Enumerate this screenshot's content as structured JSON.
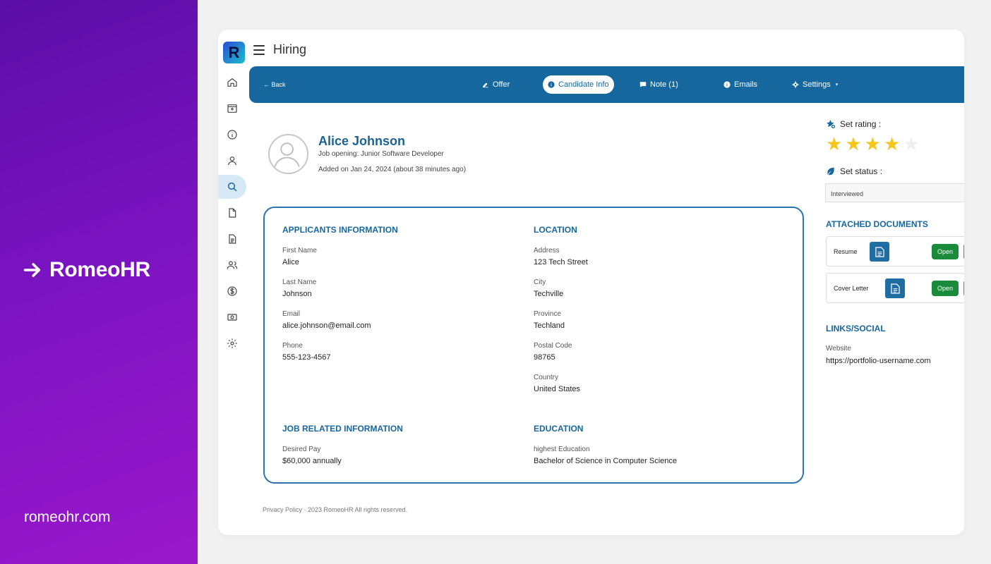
{
  "promo": {
    "brand": "RomeoHR",
    "url": "romeohr.com"
  },
  "app": {
    "logo_letter": "R",
    "title": "Hiring"
  },
  "sidebar": {
    "items": [
      {
        "icon": "home-icon"
      },
      {
        "icon": "inbox-icon"
      },
      {
        "icon": "info-icon"
      },
      {
        "icon": "user-icon"
      },
      {
        "icon": "search-icon",
        "active": true
      },
      {
        "icon": "file-icon"
      },
      {
        "icon": "document-icon"
      },
      {
        "icon": "users-icon"
      },
      {
        "icon": "dollar-icon"
      },
      {
        "icon": "cash-icon"
      },
      {
        "icon": "gear-icon"
      }
    ]
  },
  "nav": {
    "back": "← Back",
    "offer": "Offer",
    "candidate_info": "Candidate Info",
    "note": "Note (1)",
    "emails": "Emails",
    "settings": "Settings"
  },
  "candidate": {
    "name": "Alice Johnson",
    "job_opening": "Job opening: Junior Software Developer",
    "added": "Added on Jan 24, 2024 (about 38 minutes ago)"
  },
  "applicant": {
    "title": "APPLICANTS INFORMATION",
    "fields": [
      {
        "label": "First Name",
        "value": "Alice"
      },
      {
        "label": "Last Name",
        "value": "Johnson"
      },
      {
        "label": "Email",
        "value": "alice.johnson@email.com"
      },
      {
        "label": "Phone",
        "value": "555-123-4567"
      }
    ]
  },
  "location": {
    "title": "LOCATION",
    "fields": [
      {
        "label": "Address",
        "value": "123 Tech Street"
      },
      {
        "label": "City",
        "value": "Techville"
      },
      {
        "label": "Province",
        "value": "Techland"
      },
      {
        "label": "Postal Code",
        "value": "98765"
      },
      {
        "label": "Country",
        "value": "United States"
      }
    ]
  },
  "job": {
    "title": "JOB RELATED INFORMATION",
    "fields": [
      {
        "label": "Desired Pay",
        "value": "$60,000 annually"
      }
    ]
  },
  "education": {
    "title": "EDUCATION",
    "fields": [
      {
        "label": "highest Education",
        "value": "Bachelor of Science in Computer Science"
      }
    ]
  },
  "footer": "Privacy Policy ·  2023 RomeoHR All rights reserved.",
  "right": {
    "rating_label": "Set rating :",
    "rating": 4,
    "rating_max": 5,
    "status_label": "Set status :",
    "status_value": "Interviewed",
    "docs_title": "ATTACHED DOCUMENTS",
    "docs": [
      {
        "name": "Resume",
        "open": "Open"
      },
      {
        "name": "Cover Letter",
        "open": "Open"
      }
    ],
    "links_title": "LINKS/SOCIAL",
    "website_label": "Website",
    "website_value": "https://portfolio-username.com"
  },
  "colors": {
    "accent": "#15679e",
    "star": "#f5c518",
    "open_button": "#1a8a3b",
    "promo_gradient": [
      "#5a0ea6",
      "#9a18cc"
    ]
  }
}
